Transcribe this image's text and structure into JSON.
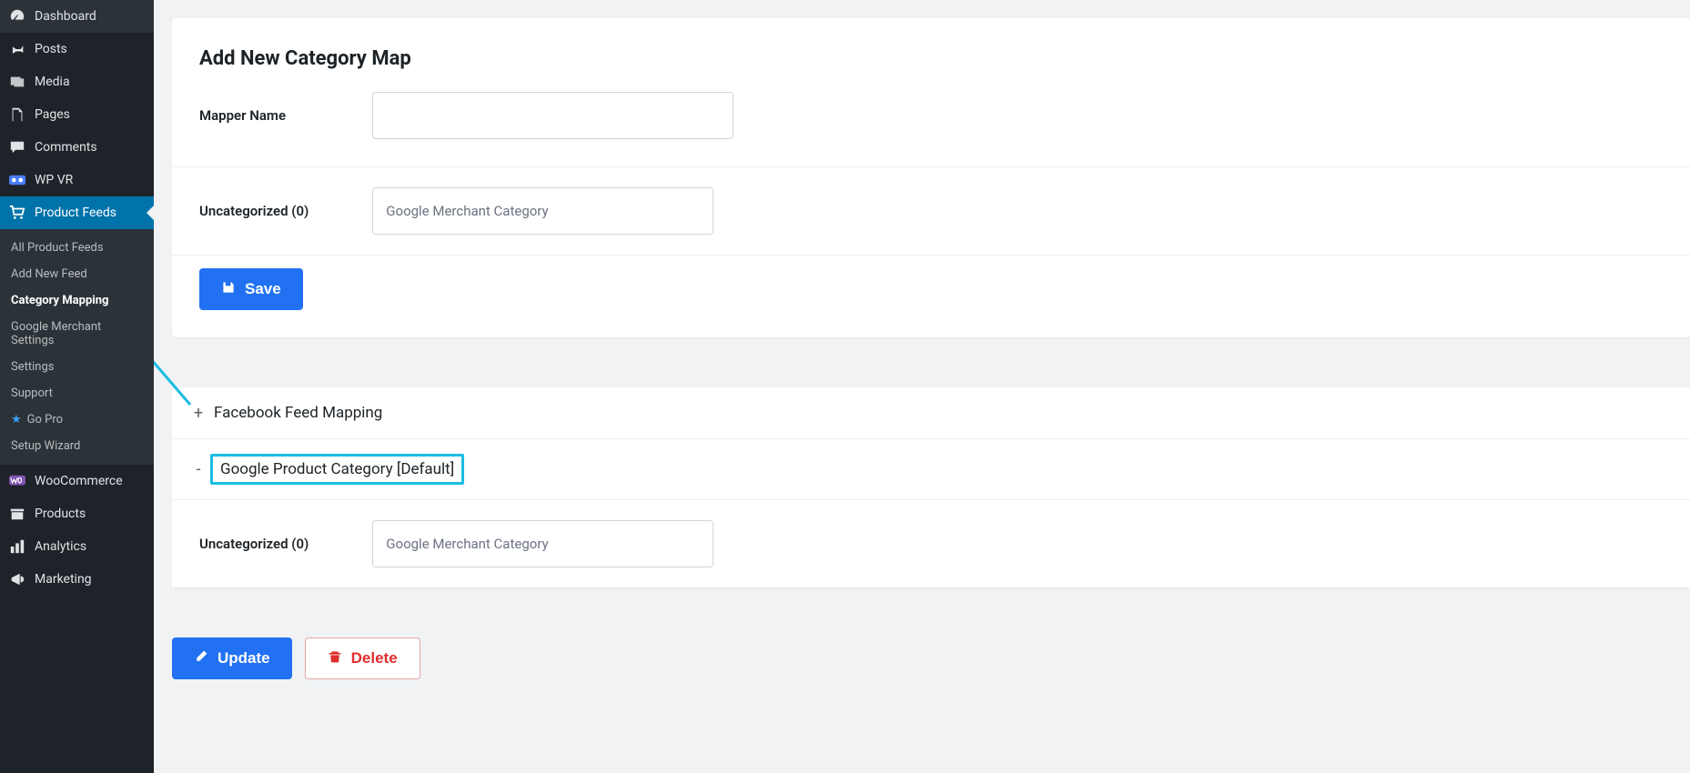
{
  "sidebar": {
    "items": [
      {
        "label": "Dashboard",
        "icon": "gauge"
      },
      {
        "label": "Posts",
        "icon": "pin"
      },
      {
        "label": "Media",
        "icon": "media"
      },
      {
        "label": "Pages",
        "icon": "pages"
      },
      {
        "label": "Comments",
        "icon": "comment"
      },
      {
        "label": "WP VR",
        "icon": "vr"
      },
      {
        "label": "Product Feeds",
        "icon": "cart"
      },
      {
        "label": "WooCommerce",
        "icon": "woo"
      },
      {
        "label": "Products",
        "icon": "archive"
      },
      {
        "label": "Analytics",
        "icon": "bars"
      },
      {
        "label": "Marketing",
        "icon": "megaphone"
      }
    ],
    "sub": [
      {
        "label": "All Product Feeds"
      },
      {
        "label": "Add New Feed"
      },
      {
        "label": "Category Mapping",
        "current": true
      },
      {
        "label": "Google Merchant Settings"
      },
      {
        "label": "Settings"
      },
      {
        "label": "Support"
      },
      {
        "label": "Go Pro",
        "star": true
      },
      {
        "label": "Setup Wizard"
      }
    ]
  },
  "page": {
    "title": "Add New Category Map",
    "mapper_name_label": "Mapper Name",
    "mapper_name_value": "",
    "row1_label": "Uncategorized (0)",
    "row1_placeholder": "Google Merchant Category",
    "save_label": "Save"
  },
  "accordion": {
    "items": [
      {
        "toggle": "+",
        "title": "Facebook Feed Mapping",
        "highlight": false
      },
      {
        "toggle": "-",
        "title": "Google Product Category [Default]",
        "highlight": true
      }
    ],
    "row_label": "Uncategorized (0)",
    "row_placeholder": "Google Merchant Category",
    "update_label": "Update",
    "delete_label": "Delete"
  }
}
